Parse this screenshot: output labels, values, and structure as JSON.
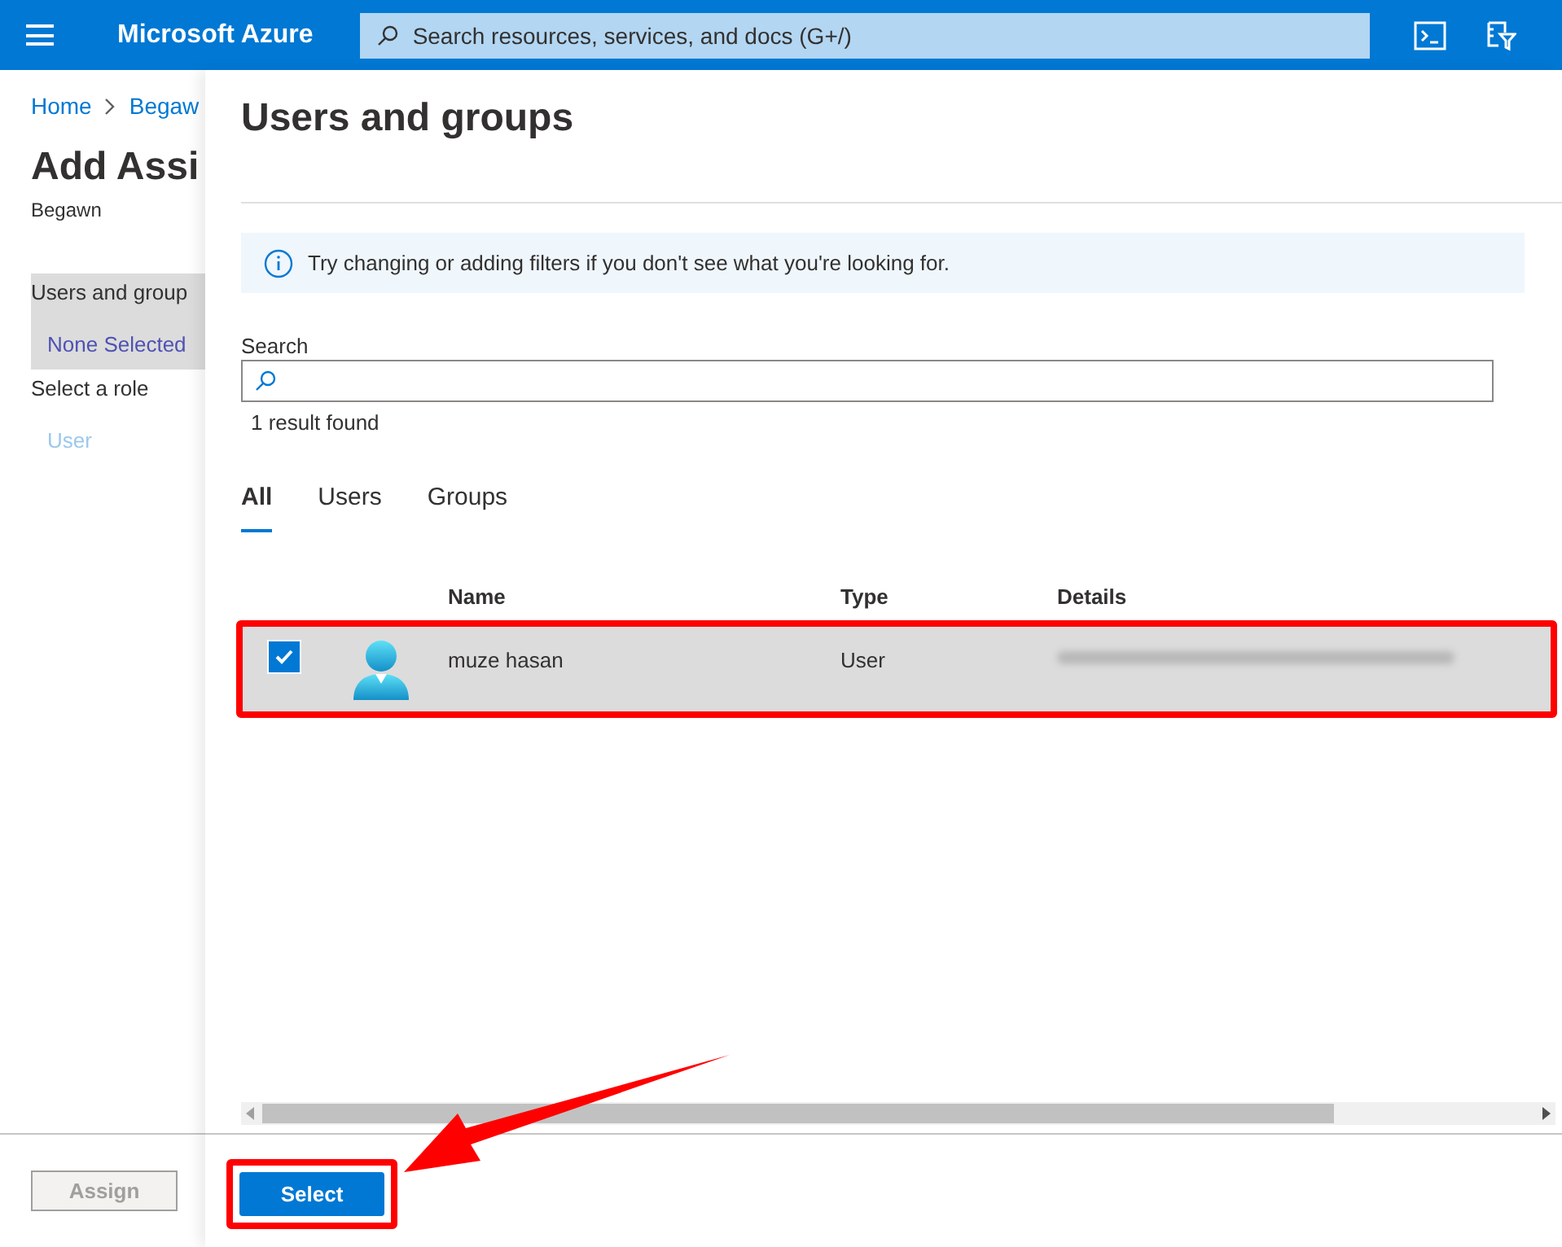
{
  "header": {
    "brand": "Microsoft Azure",
    "search": {
      "placeholder": "Search resources, services, and docs (G+/)"
    }
  },
  "page": {
    "breadcrumb": [
      "Home",
      "Begaw"
    ],
    "title": "Add Assi",
    "subtitle": "Begawn",
    "steps": [
      {
        "label": "Users and group",
        "value": "None Selected",
        "selected": true
      },
      {
        "label": "Select a role",
        "value": "User",
        "selected": false
      }
    ],
    "assign_button": {
      "label": "Assign",
      "disabled": true
    }
  },
  "panel": {
    "title": "Users and groups",
    "info": "Try changing or adding filters if you don't see what you're looking for.",
    "search": {
      "label": "Search"
    },
    "result_count": "1 result found",
    "tabs": [
      {
        "label": "All",
        "selected": true
      },
      {
        "label": "Users",
        "selected": false
      },
      {
        "label": "Groups",
        "selected": false
      }
    ],
    "table": {
      "columns": [
        "Name",
        "Type",
        "Details"
      ],
      "rows": [
        {
          "name": "muze hasan",
          "type": "User",
          "checked": true,
          "selected": true
        }
      ]
    },
    "select_button": {
      "label": "Select"
    }
  }
}
